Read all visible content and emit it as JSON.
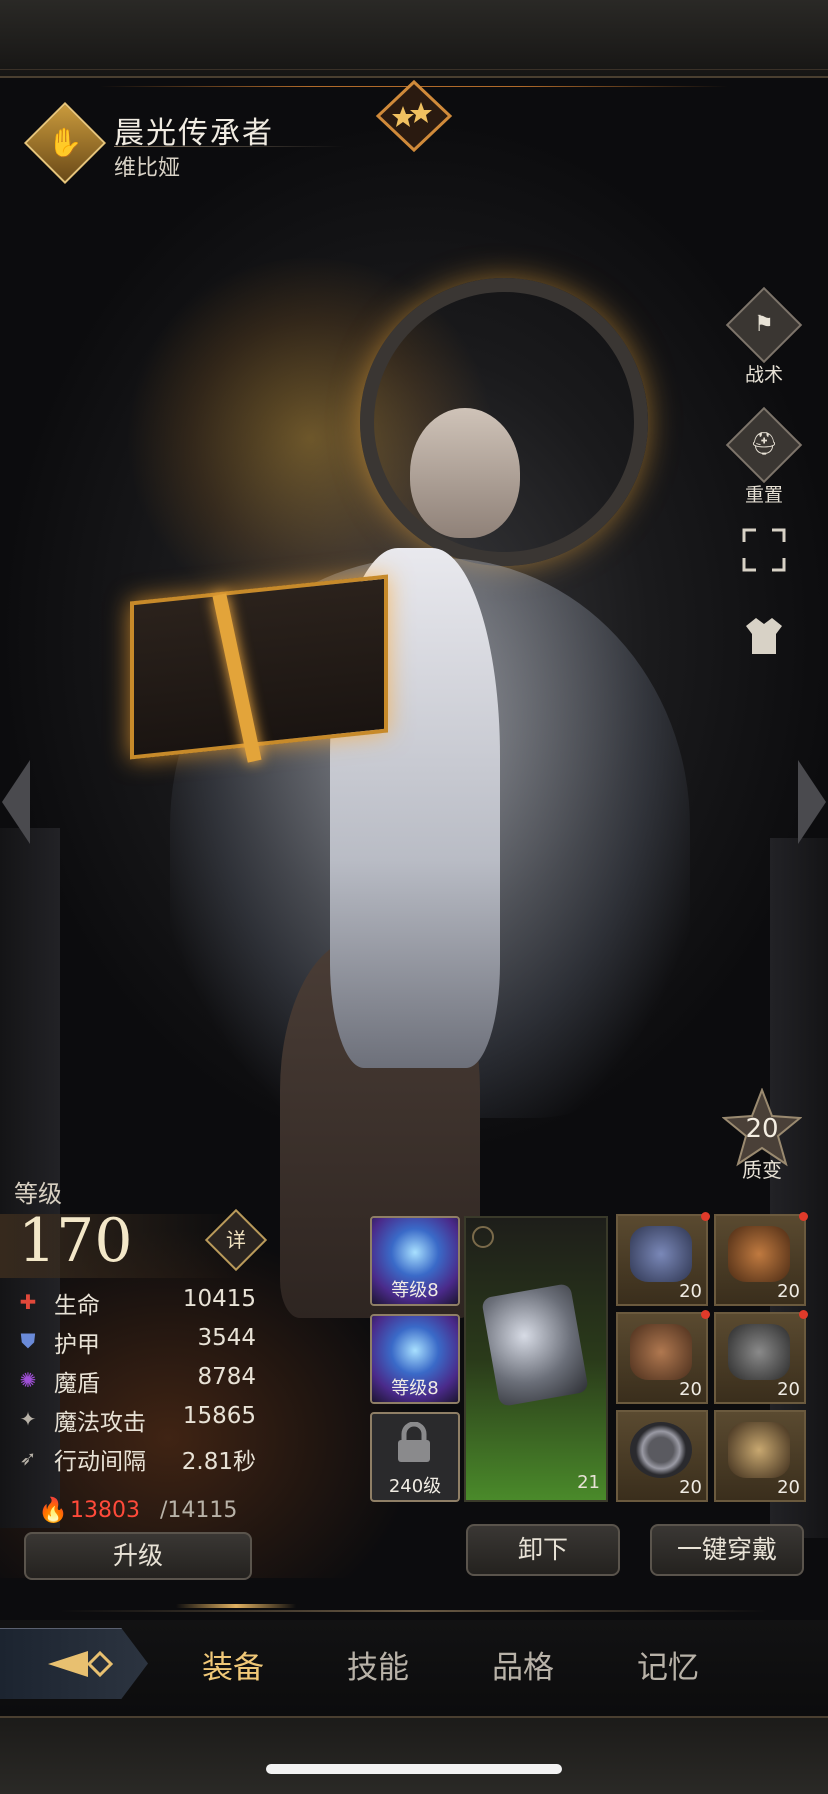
{
  "header": {
    "title": "晨光传承者",
    "name": "维比娅"
  },
  "side_buttons": {
    "tactics": "战术",
    "reset": "重置"
  },
  "quality": {
    "value": "20",
    "label": "质变"
  },
  "level": {
    "label": "等级",
    "value": "170",
    "detail_label": "详"
  },
  "stats": [
    {
      "icon": "health-icon",
      "label": "生命",
      "value": "10415",
      "color": "#e0483a"
    },
    {
      "icon": "armor-icon",
      "label": "护甲",
      "value": "3544",
      "color": "#6a8ad8"
    },
    {
      "icon": "magic-shield-icon",
      "label": "魔盾",
      "value": "8784",
      "color": "#a050d8"
    },
    {
      "icon": "magic-attack-icon",
      "label": "魔法攻击",
      "value": "15865",
      "color": "#b8b2a8"
    },
    {
      "icon": "action-interval-icon",
      "label": "行动间隔",
      "value": "2.81秒",
      "color": "#b8b2a8"
    }
  ],
  "energy": {
    "current": "13803",
    "max": "/14115"
  },
  "buttons": {
    "upgrade": "升级",
    "unequip": "卸下",
    "equip_all": "一键穿戴"
  },
  "runes": [
    {
      "level": "等级8"
    },
    {
      "level": "等级8"
    },
    {
      "level": "240级",
      "locked": true
    }
  ],
  "weapon": {
    "level": "21"
  },
  "gear": [
    {
      "name": "hat",
      "level": "20",
      "alert": true
    },
    {
      "name": "chest",
      "level": "20",
      "alert": true
    },
    {
      "name": "gloves",
      "level": "20",
      "alert": true
    },
    {
      "name": "belt",
      "level": "20",
      "alert": true
    },
    {
      "name": "ring",
      "level": "20",
      "alert": true
    },
    {
      "name": "boots",
      "level": "20",
      "alert": true
    }
  ],
  "tabs": [
    {
      "label": "装备",
      "active": true
    },
    {
      "label": "技能",
      "active": false
    },
    {
      "label": "品格",
      "active": false
    },
    {
      "label": "记忆",
      "active": false
    }
  ]
}
